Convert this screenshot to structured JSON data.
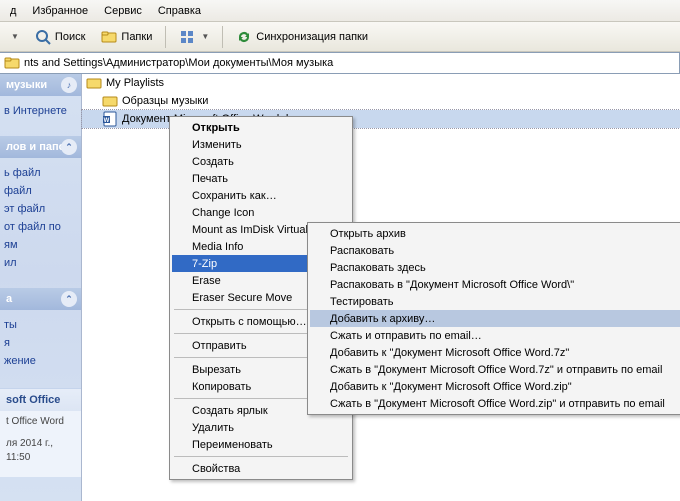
{
  "menubar": {
    "items": [
      "д",
      "Избранное",
      "Сервис",
      "Справка"
    ]
  },
  "toolbar": {
    "search_label": "Поиск",
    "folders_label": "Папки",
    "sync_label": "Синхронизация папки"
  },
  "addressbar": {
    "path": "nts and Settings\\Администратор\\Мои документы\\Моя музыка"
  },
  "sidebar": {
    "music_header": "музыки",
    "music_row1": "в Интернете",
    "files_header": "лов и папок",
    "rows": [
      "ь файл",
      "файл",
      "эт файл",
      "от файл по",
      "ям",
      "ил"
    ],
    "places_header": "а",
    "places_rows": [
      "ты",
      "я",
      "жение"
    ],
    "details_header": "soft Office",
    "details_line1": "t Office Word",
    "details_line2": "ля 2014 г., 11:50"
  },
  "tree": {
    "item1": "My Playlists",
    "item2": "Образцы музыки",
    "item3": "Документ Microsoft Office Word.docx"
  },
  "ctx": {
    "open": "Открыть",
    "edit": "Изменить",
    "create": "Создать",
    "print": "Печать",
    "saveas": "Сохранить как…",
    "changeicon": "Change Icon",
    "mount": "Mount as ImDisk Virtual Disk",
    "mediainfo": "Media Info",
    "sevenzip": "7-Zip",
    "erase": "Erase",
    "erasesecure": "Eraser Secure Move",
    "openwith": "Открыть с помощью…",
    "sendto": "Отправить",
    "cut": "Вырезать",
    "copy": "Копировать",
    "shortcut": "Создать ярлык",
    "delete": "Удалить",
    "rename": "Переименовать",
    "properties": "Свойства"
  },
  "sub": {
    "openarc": "Открыть архив",
    "extract": "Распаковать",
    "extracthere": "Распаковать здесь",
    "extractto": "Распаковать в \"Документ Microsoft Office Word\\\"",
    "test": "Тестировать",
    "addto": "Добавить к архиву…",
    "compressemail": "Сжать и отправить по email…",
    "add7z": "Добавить к \"Документ Microsoft Office Word.7z\"",
    "comp7zemail": "Сжать в \"Документ Microsoft Office Word.7z\" и отправить по email",
    "addzip": "Добавить к \"Документ Microsoft Office Word.zip\"",
    "compzipemail": "Сжать в \"Документ Microsoft Office Word.zip\" и отправить по email"
  }
}
